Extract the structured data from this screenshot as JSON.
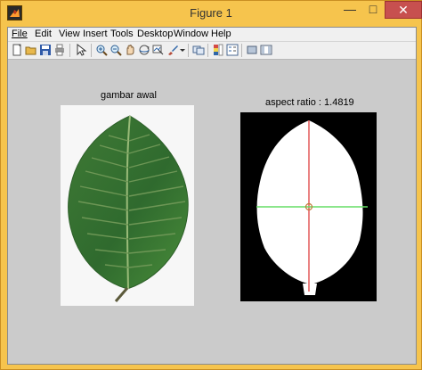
{
  "window": {
    "title": "Figure 1",
    "controls": {
      "minimize": "—",
      "maximize": "□",
      "close": "✕"
    }
  },
  "menu": [
    {
      "label": "File"
    },
    {
      "label": "Edit"
    },
    {
      "label": "View"
    },
    {
      "label": "Insert"
    },
    {
      "label": "Tools"
    },
    {
      "label": "Desktop"
    },
    {
      "label": "Window"
    },
    {
      "label": "Help"
    }
  ],
  "toolbar": [
    {
      "icon": "new-figure-icon"
    },
    {
      "icon": "open-file-icon"
    },
    {
      "icon": "save-figure-icon"
    },
    {
      "icon": "print-figure-icon"
    },
    {
      "icon": "edit-plot-icon"
    },
    {
      "icon": "zoom-in-icon"
    },
    {
      "icon": "zoom-out-icon"
    },
    {
      "icon": "pan-icon"
    },
    {
      "icon": "rotate-3d-icon"
    },
    {
      "icon": "data-cursor-icon"
    },
    {
      "icon": "brush-icon"
    },
    {
      "icon": "dropdown-arrow-icon"
    },
    {
      "icon": "link-plot-icon"
    },
    {
      "icon": "insert-colorbar-icon"
    },
    {
      "icon": "insert-legend-icon"
    },
    {
      "icon": "hide-plot-tools-icon"
    },
    {
      "icon": "show-plot-tools-icon"
    }
  ],
  "figure": {
    "left_title": "gambar awal",
    "right_title": "aspect ratio : 1.4819"
  }
}
